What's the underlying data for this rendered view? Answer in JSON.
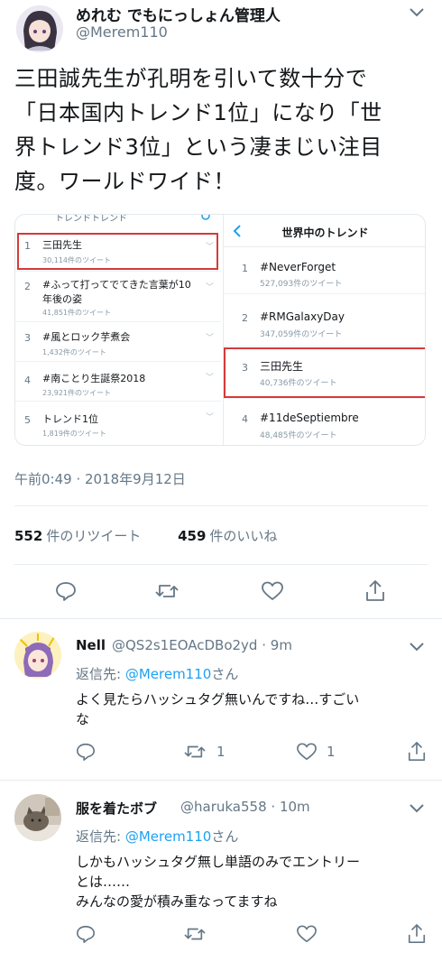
{
  "main_tweet": {
    "display_name": "めれむ でもにっしょん管理人",
    "handle": "@Merem110",
    "text_lines": [
      "三田誠先生が孔明を引いて数十分で",
      "「日本国内トレンド1位」になり「世",
      "界トレンド3位」という凄まじい注目",
      "度。ワールドワイド！"
    ],
    "timestamp": "午前0:49 · 2018年9月12日",
    "retweet_count": "552",
    "retweet_label": "件のリツイート",
    "like_count": "459",
    "like_label": "件のいいね"
  },
  "embed": {
    "left_header": "トレンドトレンド",
    "right_title": "世界中のトレンド",
    "japan_trends": [
      {
        "rank": "1",
        "name": "三田先生",
        "count": "30,114件のツイート"
      },
      {
        "rank": "2",
        "name": "#ふって打ってでてきた言葉が10\n年後の姿",
        "count": "41,851件のツイート"
      },
      {
        "rank": "3",
        "name": "#風とロック芋煮会",
        "count": "1,432件のツイート"
      },
      {
        "rank": "4",
        "name": "#南ことり生誕祭2018",
        "count": "23,921件のツイート"
      },
      {
        "rank": "5",
        "name": "トレンド1位",
        "count": "1,819件のツイート"
      }
    ],
    "world_trends": [
      {
        "rank": "1",
        "name": "#NeverForget",
        "count": "527,093件のツイート"
      },
      {
        "rank": "2",
        "name": "#RMGalaxyDay",
        "count": "347,059件のツイート"
      },
      {
        "rank": "3",
        "name": "三田先生",
        "count": "40,736件のツイート"
      },
      {
        "rank": "4",
        "name": "#11deSeptiembre",
        "count": "48,485件のツイート"
      }
    ]
  },
  "replies": [
    {
      "display_name": "Nell",
      "handle": "@QS2s1EOAcDBo2yd",
      "time": "· 9m",
      "reply_prefix": "返信先: ",
      "reply_to": "@Merem110",
      "reply_suffix": "さん",
      "text_lines": [
        "よく見たらハッシュタグ無いんですね…すごい",
        "な"
      ],
      "retweets": "1",
      "likes": "1"
    },
    {
      "display_name": "服を着たボブ",
      "handle": "@haruka558",
      "time": "· 10m",
      "reply_prefix": "返信先: ",
      "reply_to": "@Merem110",
      "reply_suffix": "さん",
      "text_lines": [
        "しかもハッシュタグ無し単語のみでエントリー",
        "とは……",
        "みんなの愛が積み重なってますね"
      ],
      "retweets": "",
      "likes": ""
    }
  ],
  "icons": {
    "reply": "reply-icon",
    "retweet": "retweet-icon",
    "like": "heart-icon",
    "share": "share-icon",
    "more": "chevron-down-icon",
    "back": "chevron-left-icon",
    "settings": "gear-icon"
  },
  "colors": {
    "text": "#14171a",
    "muted": "#657786",
    "link": "#1da1f2",
    "highlight": "#d53a3a",
    "divider": "#e6ecf0"
  }
}
